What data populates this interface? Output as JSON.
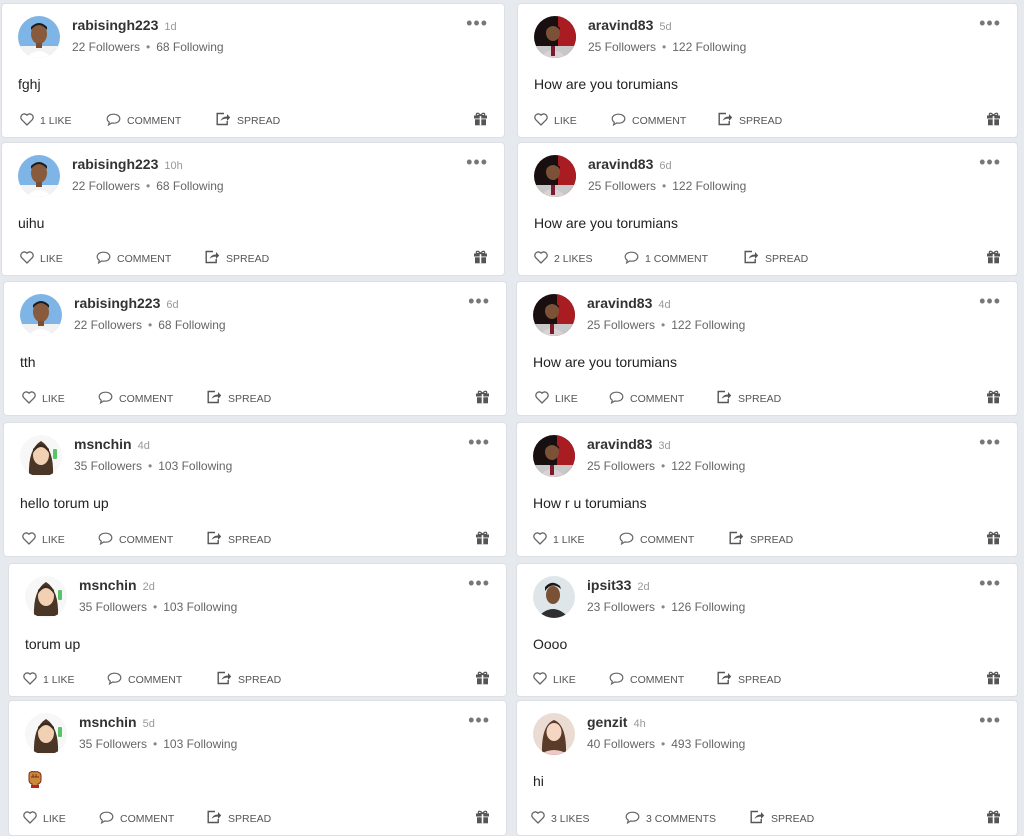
{
  "icons": {
    "like": "heart-outline-icon",
    "comment": "speech-bubble-icon",
    "spread": "share-arrow-icon",
    "gift": "gift-icon",
    "more": "more-dots-icon"
  },
  "more_glyph": "•••",
  "posts": [
    {
      "username": "rabisingh223",
      "time": "1d",
      "followers": "22 Followers",
      "following": "68 Following",
      "text": "fghj",
      "like": "1 LIKE",
      "comment": "COMMENT",
      "spread": "SPREAD"
    },
    {
      "username": "aravind83",
      "time": "5d",
      "followers": "25 Followers",
      "following": "122 Following",
      "text": "How are you torumians",
      "like": "LIKE",
      "comment": "COMMENT",
      "spread": "SPREAD"
    },
    {
      "username": "rabisingh223",
      "time": "10h",
      "followers": "22 Followers",
      "following": "68 Following",
      "text": "uihu",
      "like": "LIKE",
      "comment": "COMMENT",
      "spread": "SPREAD"
    },
    {
      "username": "aravind83",
      "time": "6d",
      "followers": "25 Followers",
      "following": "122 Following",
      "text": "How are you torumians",
      "like": "2 LIKES",
      "comment": "1 COMMENT",
      "spread": "SPREAD"
    },
    {
      "username": "rabisingh223",
      "time": "6d",
      "followers": "22 Followers",
      "following": "68 Following",
      "text": "tth",
      "like": "LIKE",
      "comment": "COMMENT",
      "spread": "SPREAD"
    },
    {
      "username": "aravind83",
      "time": "4d",
      "followers": "25 Followers",
      "following": "122 Following",
      "text": "How are you torumians",
      "like": "LIKE",
      "comment": "COMMENT",
      "spread": "SPREAD"
    },
    {
      "username": "msnchin",
      "time": "4d",
      "followers": "35 Followers",
      "following": "103 Following",
      "text": "hello torum up",
      "like": "LIKE",
      "comment": "COMMENT",
      "spread": "SPREAD"
    },
    {
      "username": "aravind83",
      "time": "3d",
      "followers": "25 Followers",
      "following": "122 Following",
      "text": "How r u torumians",
      "like": "1 LIKE",
      "comment": "COMMENT",
      "spread": "SPREAD"
    },
    {
      "username": "msnchin",
      "time": "2d",
      "followers": "35 Followers",
      "following": "103 Following",
      "text": "torum up",
      "like": "1 LIKE",
      "comment": "COMMENT",
      "spread": "SPREAD"
    },
    {
      "username": "ipsit33",
      "time": "2d",
      "followers": "23 Followers",
      "following": "126 Following",
      "text": "Oooo",
      "like": "LIKE",
      "comment": "COMMENT",
      "spread": "SPREAD"
    },
    {
      "username": "msnchin",
      "time": "5d",
      "followers": "35 Followers",
      "following": "103 Following",
      "text": "",
      "like": "LIKE",
      "comment": "COMMENT",
      "spread": "SPREAD"
    },
    {
      "username": "genzit",
      "time": "4h",
      "followers": "40 Followers",
      "following": "493 Following",
      "text": "hi",
      "like": "3 LIKES",
      "comment": "3 COMMENTS",
      "spread": "SPREAD"
    }
  ]
}
